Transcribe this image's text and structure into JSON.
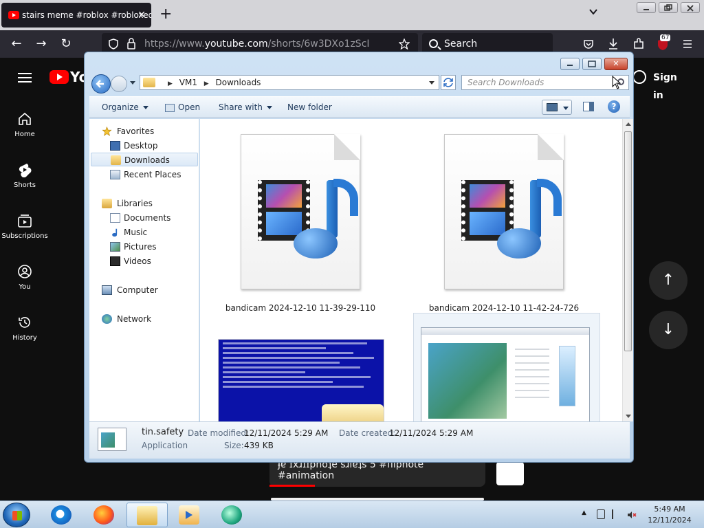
{
  "browser": {
    "tab_title": "stairs meme #roblox #robloxedit",
    "tab_close": "✕",
    "new_tab": "+",
    "url_prefix": "https://www.",
    "url_domain": "youtube.com",
    "url_path": "/shorts/6w3DXo1zScI",
    "search_placeholder": "Search",
    "extension_badge": "67",
    "nav_back": "←",
    "nav_forward": "→",
    "nav_reload": "↻",
    "icons": [
      "back-arrow-icon",
      "forward-arrow-icon",
      "reload-icon",
      "shield-icon",
      "lock-icon",
      "star-icon",
      "pocket-icon",
      "download-icon",
      "extensions-icon",
      "menu-icon"
    ]
  },
  "youtube": {
    "logo_text": "Yo",
    "sign_in": "Sign in",
    "sidebar": [
      {
        "label": "Home",
        "icon": "home-icon"
      },
      {
        "label": "Shorts",
        "icon": "shorts-icon"
      },
      {
        "label": "Subscriptions",
        "icon": "subscriptions-icon"
      },
      {
        "label": "You",
        "icon": "user-icon"
      },
      {
        "label": "History",
        "icon": "history-icon"
      }
    ],
    "up_arrow": "↑",
    "down_arrow": "↓",
    "card_text": "ɟɐ ɪxɹɪɪpnoʇe   sɹıɐʇs 5 #flipnote #animation"
  },
  "explorer": {
    "window_close": "✕",
    "address": {
      "breadcrumbs": [
        "VM1",
        "Downloads"
      ],
      "separator": "▶"
    },
    "search_placeholder": "Search Downloads",
    "toolbar": {
      "organize": "Organize",
      "open": "Open",
      "share_with": "Share with",
      "new_folder": "New folder",
      "help": "?"
    },
    "nav_pane": {
      "favorites": "Favorites",
      "favorites_items": [
        "Desktop",
        "Downloads",
        "Recent Places"
      ],
      "libraries": "Libraries",
      "libraries_items": [
        "Documents",
        "Music",
        "Pictures",
        "Videos"
      ],
      "computer": "Computer",
      "network": "Network",
      "selected": "Downloads"
    },
    "files": [
      {
        "name": "bandicam 2024-12-10 11-39-29-110",
        "type": "media-file-icon"
      },
      {
        "name": "bandicam 2024-12-10 11-42-24-726",
        "type": "media-file-icon"
      }
    ],
    "details": {
      "name": "tin.safety",
      "type": "Application",
      "date_modified_label": "Date modified:",
      "date_modified": "12/11/2024 5:29 AM",
      "date_created_label": "Date created:",
      "date_created": "12/11/2024 5:29 AM",
      "size_label": "Size:",
      "size": "439 KB"
    }
  },
  "taskbar": {
    "apps": [
      "internet-explorer-icon",
      "firefox-icon",
      "folder-icon",
      "media-player-icon",
      "app-icon"
    ],
    "active_app": "folder-icon",
    "time": "5:49 AM",
    "date": "12/11/2024",
    "tray_expand": "▲"
  }
}
